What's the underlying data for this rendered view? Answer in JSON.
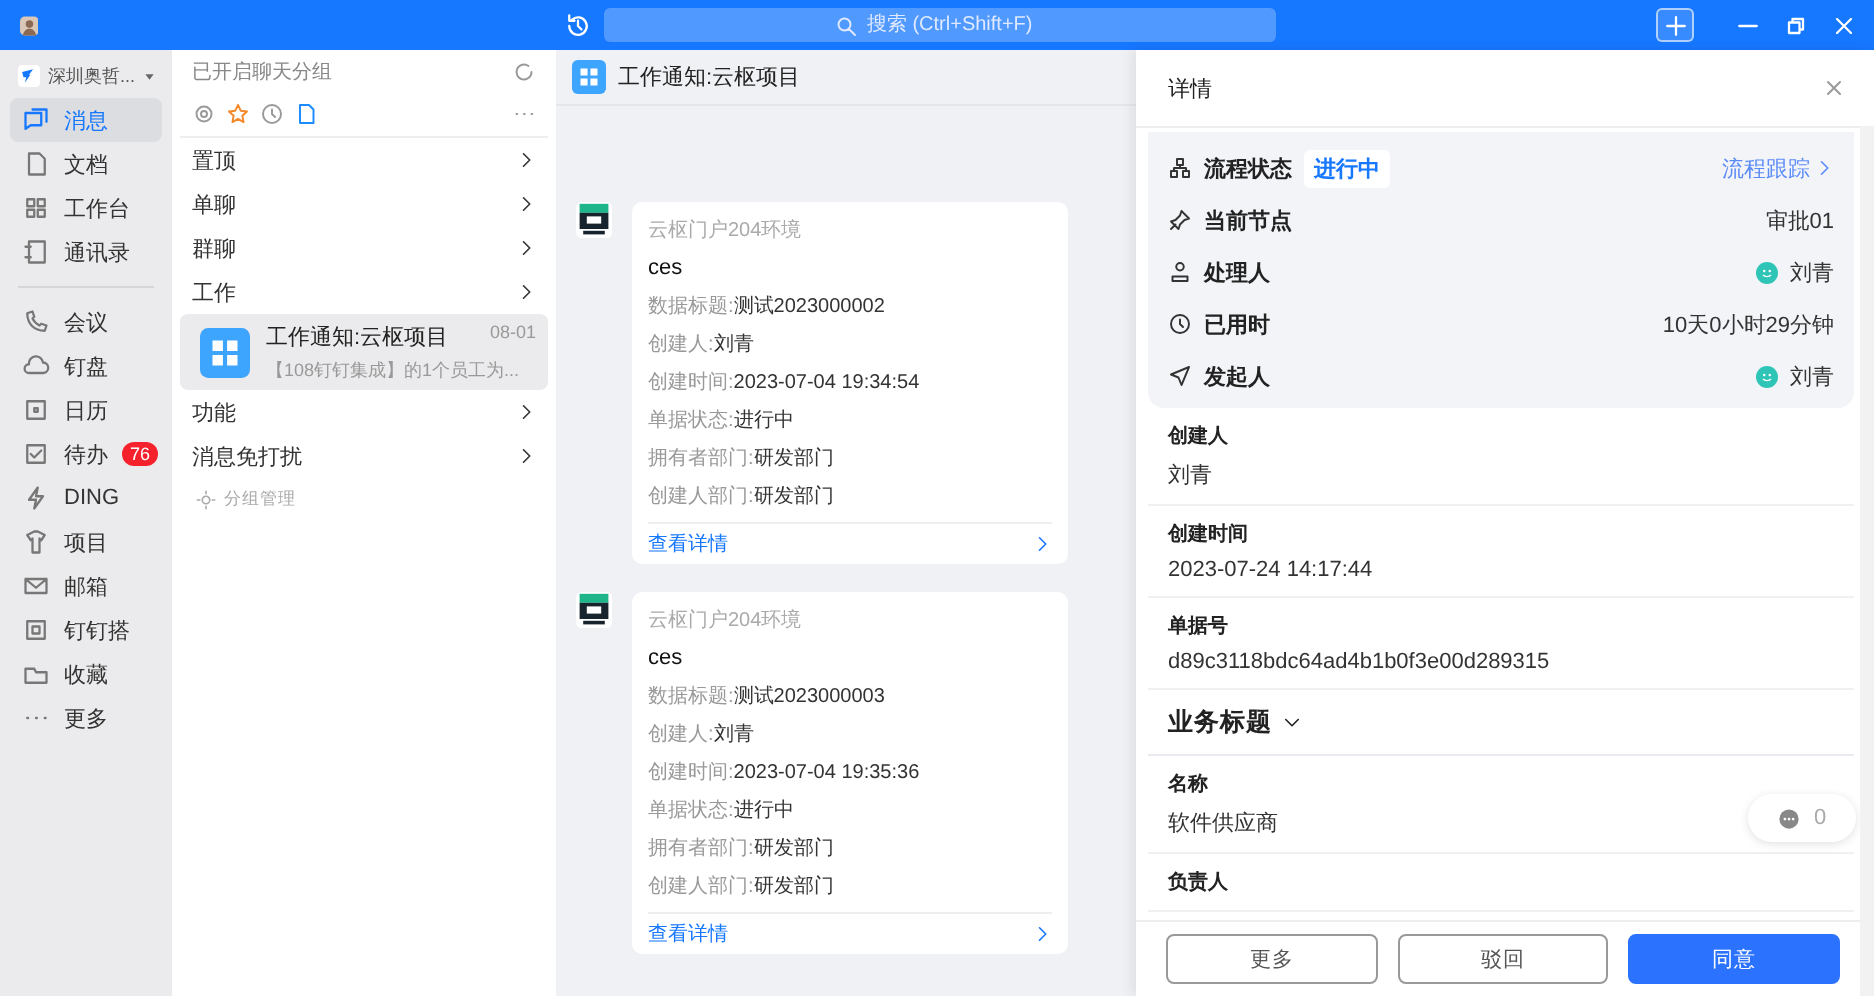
{
  "topbar": {
    "search": {
      "placeholder": "搜索 (Ctrl+Shift+F)"
    }
  },
  "sidebar": {
    "org": "深圳奥哲...",
    "groups": [
      {
        "items": [
          {
            "label": "消息",
            "selected": true
          },
          {
            "label": "文档",
            "selected": false
          },
          {
            "label": "工作台",
            "selected": false
          },
          {
            "label": "通讯录",
            "selected": false
          }
        ]
      },
      {
        "items": [
          {
            "label": "会议",
            "selected": false
          },
          {
            "label": "钉盘",
            "selected": false
          },
          {
            "label": "日历",
            "selected": false
          },
          {
            "label": "待办",
            "selected": false,
            "badge": "76"
          },
          {
            "label": "DING",
            "selected": false
          },
          {
            "label": "项目",
            "selected": false
          },
          {
            "label": "邮箱",
            "selected": false
          },
          {
            "label": "钉钉搭",
            "selected": false
          },
          {
            "label": "收藏",
            "selected": false
          },
          {
            "label": "更多",
            "selected": false
          }
        ]
      }
    ]
  },
  "chat_list": {
    "header": "已开启聊天分组",
    "rows": [
      {
        "kind": "group",
        "label": "置顶"
      },
      {
        "kind": "group",
        "label": "单聊"
      },
      {
        "kind": "group",
        "label": "群聊"
      },
      {
        "kind": "group",
        "label": "工作"
      },
      {
        "kind": "chat",
        "title": "工作通知:云枢项目",
        "time": "08-01",
        "preview": "【108钉钉集成】的1个员工为...",
        "selected": true
      },
      {
        "kind": "group",
        "label": "功能"
      },
      {
        "kind": "group",
        "label": "消息免打扰"
      }
    ],
    "manage": "分组管理"
  },
  "chat": {
    "title": "工作通知:云枢项目",
    "messages": [
      {
        "sender": "云枢门户204环境",
        "title": "ces",
        "fields": [
          {
            "label": "数据标题:",
            "value": "测试2023000002"
          },
          {
            "label": "创建人:",
            "value": "刘青"
          },
          {
            "label": "创建时间:",
            "value": "2023-07-04 19:34:54"
          },
          {
            "label": "单据状态:",
            "value": "进行中"
          },
          {
            "label": "拥有者部门:",
            "value": "研发部门"
          },
          {
            "label": "创建人部门:",
            "value": "研发部门"
          }
        ],
        "link": "查看详情"
      },
      {
        "sender": "云枢门户204环境",
        "title": "ces",
        "fields": [
          {
            "label": "数据标题:",
            "value": "测试2023000003"
          },
          {
            "label": "创建人:",
            "value": "刘青"
          },
          {
            "label": "创建时间:",
            "value": "2023-07-04 19:35:36"
          },
          {
            "label": "单据状态:",
            "value": "进行中"
          },
          {
            "label": "拥有者部门:",
            "value": "研发部门"
          },
          {
            "label": "创建人部门:",
            "value": "研发部门"
          }
        ],
        "link": "查看详情"
      }
    ]
  },
  "detail": {
    "title": "详情",
    "status": {
      "label": "流程状态",
      "value": "进行中",
      "link": "流程跟踪"
    },
    "info_rows": [
      {
        "kind": "text",
        "label": "当前节点",
        "value": "审批01"
      },
      {
        "kind": "person",
        "label": "处理人",
        "value": "刘青"
      },
      {
        "kind": "text",
        "label": "已用时",
        "value": "10天0小时29分钟"
      },
      {
        "kind": "person",
        "label": "发起人",
        "value": "刘青"
      }
    ],
    "fields": [
      {
        "label": "创建人",
        "value": "刘青"
      },
      {
        "label": "创建时间",
        "value": "2023-07-24 14:17:44"
      },
      {
        "label": "单据号",
        "value": "d89c3118bdc64ad4b1b0f3e00d289315"
      }
    ],
    "section": {
      "title": "业务标题",
      "expanded": true
    },
    "section_fields": [
      {
        "label": "名称",
        "value": "软件供应商"
      },
      {
        "label": "负责人"
      }
    ],
    "comments": {
      "count": "0"
    },
    "buttons": [
      {
        "kind": "secondary",
        "label": "更多"
      },
      {
        "kind": "secondary",
        "label": "驳回"
      },
      {
        "kind": "primary",
        "label": "同意"
      }
    ]
  }
}
